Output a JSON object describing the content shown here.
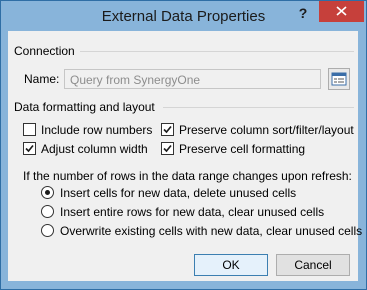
{
  "window": {
    "title": "External Data Properties",
    "help_glyph": "?"
  },
  "connection": {
    "section_label": "Connection",
    "name_label": "Name:",
    "name_value": "Query from SynergyOne"
  },
  "formatting": {
    "section_label": "Data formatting and layout",
    "checkboxes": [
      {
        "label": "Include row numbers",
        "checked": false
      },
      {
        "label": "Adjust column width",
        "checked": true
      },
      {
        "label": "Preserve column sort/filter/layout",
        "checked": true
      },
      {
        "label": "Preserve cell formatting",
        "checked": true
      }
    ]
  },
  "refresh": {
    "prompt": "If the number of rows in the data range changes upon refresh:",
    "options": [
      {
        "label": "Insert cells for new data, delete unused cells",
        "selected": true
      },
      {
        "label": "Insert entire rows for new data, clear unused cells",
        "selected": false
      },
      {
        "label": "Overwrite existing cells with new data, clear unused cells",
        "selected": false
      }
    ]
  },
  "buttons": {
    "ok_label": "OK",
    "cancel_label": "Cancel"
  }
}
